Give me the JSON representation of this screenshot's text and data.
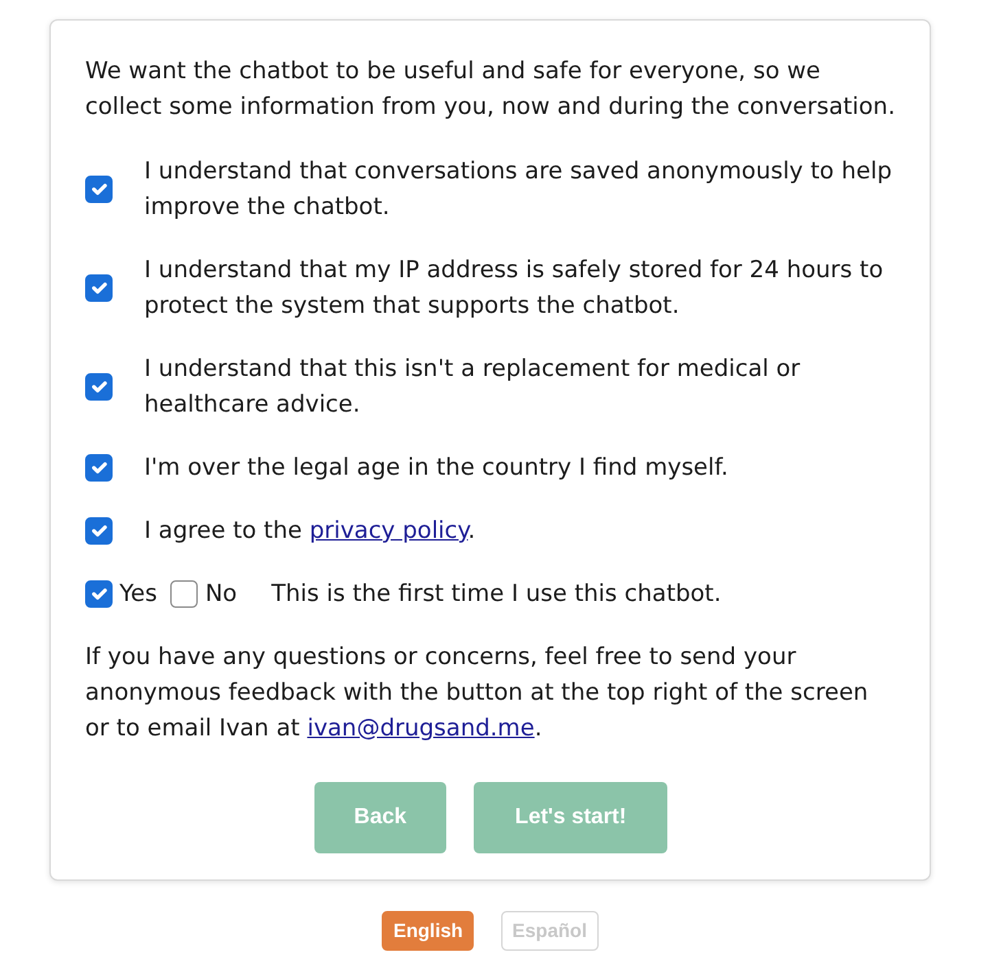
{
  "intro": "We want the chatbot to be useful and safe for everyone, so we collect some information from you, now and during the conversation.",
  "consents": [
    {
      "text": "I understand that conversations are saved anonymously to help improve the chatbot.",
      "checked": true
    },
    {
      "text": "I understand that my IP address is safely stored for 24 hours to protect the system that supports the chatbot.",
      "checked": true
    },
    {
      "text": "I understand that this isn't a replacement for medical or healthcare advice.",
      "checked": true
    },
    {
      "text": "I'm over the legal age in the country I find myself.",
      "checked": true
    },
    {
      "text": "I agree to the ",
      "link": "privacy policy",
      "text_after": ".",
      "checked": true
    }
  ],
  "first_time": {
    "options": [
      {
        "label": "Yes",
        "checked": true
      },
      {
        "label": "No",
        "checked": false
      }
    ],
    "text": "This is the first time I use this chatbot."
  },
  "contact": {
    "text": "If you have any questions or concerns, feel free to send your anonymous feedback with the button at the top right of the screen or to email Ivan at ",
    "link": "ivan@drugsand.me",
    "text_after": "."
  },
  "buttons": [
    {
      "label": "Back"
    },
    {
      "label": "Let's start!"
    }
  ],
  "languages": [
    {
      "label": "English",
      "selected": true
    },
    {
      "label": "Español",
      "selected": false
    }
  ]
}
